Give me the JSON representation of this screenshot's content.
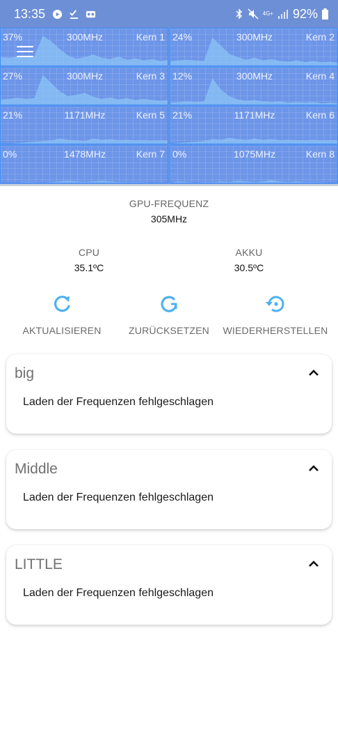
{
  "status_bar": {
    "time": "13:35",
    "battery": "92%",
    "network": "4G+",
    "left_icons": [
      "youtube-icon",
      "checkmark-download-icon",
      "voicemail-icon"
    ],
    "right_icons": [
      "bluetooth-icon",
      "mute-icon",
      "signal-icon",
      "battery-icon"
    ]
  },
  "cores": [
    {
      "load": "37%",
      "freq": "300MHz",
      "name": "Kern 1",
      "graph": [
        0.3,
        0.28,
        0.31,
        0.3,
        0.32,
        0.95,
        0.78,
        0.55,
        0.35,
        0.25,
        0.3,
        0.38,
        0.28,
        0.24,
        0.32,
        0.22,
        0.26,
        0.2,
        0.24,
        0.18,
        0.22
      ]
    },
    {
      "load": "24%",
      "freq": "300MHz",
      "name": "Kern 2",
      "graph": [
        0.18,
        0.2,
        0.22,
        0.2,
        0.18,
        0.9,
        0.65,
        0.4,
        0.3,
        0.22,
        0.28,
        0.2,
        0.24,
        0.18,
        0.16,
        0.2,
        0.15,
        0.18,
        0.14,
        0.16,
        0.12
      ]
    },
    {
      "load": "27%",
      "freq": "300MHz",
      "name": "Kern 3",
      "graph": [
        0.2,
        0.22,
        0.25,
        0.22,
        0.24,
        0.95,
        0.7,
        0.45,
        0.3,
        0.34,
        0.4,
        0.28,
        0.22,
        0.26,
        0.2,
        0.24,
        0.18,
        0.22,
        0.18,
        0.16,
        0.18
      ]
    },
    {
      "load": "12%",
      "freq": "300MHz",
      "name": "Kern 4",
      "graph": [
        0.1,
        0.12,
        0.14,
        0.12,
        0.14,
        0.85,
        0.5,
        0.3,
        0.2,
        0.16,
        0.18,
        0.14,
        0.12,
        0.14,
        0.1,
        0.12,
        0.1,
        0.12,
        0.08,
        0.1,
        0.08
      ]
    },
    {
      "load": "21%",
      "freq": "1171MHz",
      "name": "Kern 5",
      "graph": [
        0.02,
        0.04,
        0.06,
        0.08,
        0.1,
        0.12,
        0.14,
        0.2,
        0.16,
        0.14,
        0.12,
        0.2,
        0.16,
        0.18,
        0.15,
        0.16,
        0.14,
        0.15,
        0.13,
        0.14,
        0.14
      ]
    },
    {
      "load": "21%",
      "freq": "1171MHz",
      "name": "Kern 6",
      "graph": [
        0.04,
        0.06,
        0.08,
        0.1,
        0.12,
        0.18,
        0.16,
        0.22,
        0.18,
        0.16,
        0.2,
        0.16,
        0.18,
        0.15,
        0.16,
        0.15,
        0.14,
        0.16,
        0.14,
        0.15,
        0.14
      ]
    },
    {
      "load": "0%",
      "freq": "1478MHz",
      "name": "Kern 7",
      "graph": [
        0.0,
        0.02,
        0.04,
        0.06,
        0.05,
        0.04,
        0.06,
        0.08,
        0.1,
        0.08,
        0.06,
        0.08,
        0.1,
        0.08,
        0.06,
        0.05,
        0.06,
        0.05,
        0.04,
        0.05,
        0.04
      ]
    },
    {
      "load": "0%",
      "freq": "1075MHz",
      "name": "Kern 8",
      "graph": [
        0.04,
        0.08,
        0.06,
        0.04,
        0.06,
        0.05,
        0.08,
        0.06,
        0.1,
        0.08,
        0.06,
        0.08,
        0.12,
        0.08,
        0.06,
        0.08,
        0.05,
        0.06,
        0.05,
        0.04,
        0.05
      ]
    }
  ],
  "gpu": {
    "label": "GPU-FREQUENZ",
    "value": "305MHz"
  },
  "temperatures": {
    "cpu": {
      "label": "CPU",
      "value": "35.1ºC"
    },
    "akku": {
      "label": "AKKU",
      "value": "30.5ºC"
    }
  },
  "actions": [
    {
      "label": "AKTUALISIEREN",
      "icon": "refresh-icon"
    },
    {
      "label": "ZURÜCKSETZEN",
      "icon": "reset-icon"
    },
    {
      "label": "WIEDERHERSTELLEN",
      "icon": "restore-icon"
    }
  ],
  "clusters": [
    {
      "title": "big",
      "message": "Laden der Frequenzen fehlgeschlagen"
    },
    {
      "title": "Middle",
      "message": "Laden der Frequenzen fehlgeschlagen"
    },
    {
      "title": "LITTLE",
      "message": "Laden der Frequenzen fehlgeschlagen"
    }
  ],
  "colors": {
    "status_bar": "#6d8fd6",
    "core_bg": "#6d95e8",
    "core_border": "#3a8df5",
    "graph_fill": "#8cc4f5",
    "accent": "#4fb0f0"
  }
}
